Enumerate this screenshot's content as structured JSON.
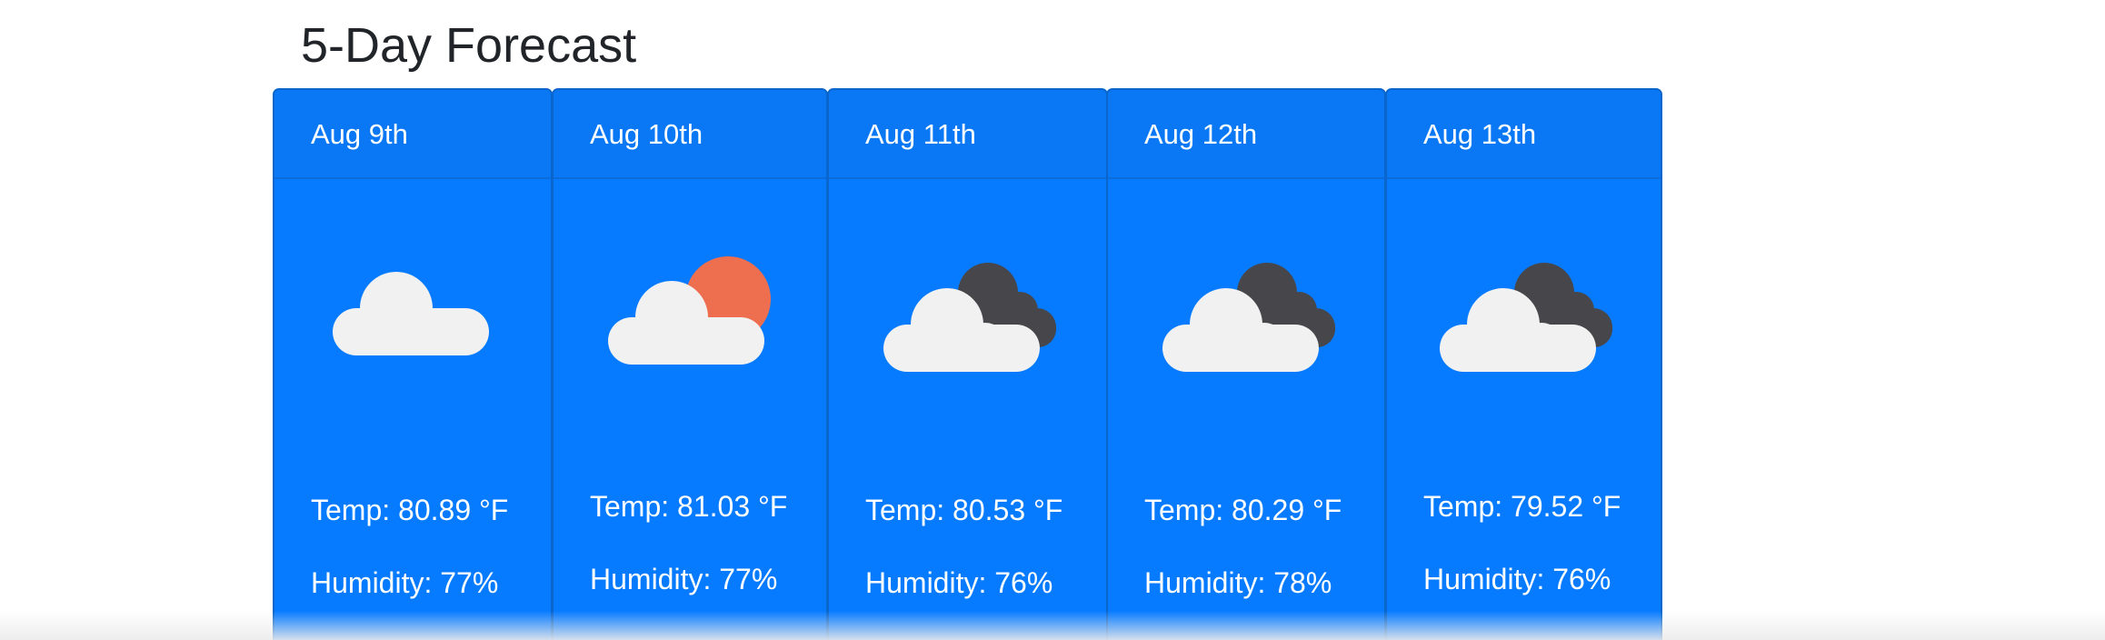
{
  "page": {
    "title": "5-Day Forecast"
  },
  "colors": {
    "card_background": "#077bff",
    "cloud": "#f1f1f1",
    "dark_cloud": "#47474b",
    "sun": "#ee6f4f"
  },
  "forecast": [
    {
      "date": "Aug 9th",
      "icon": "cloud-icon",
      "temp": "Temp: 80.89 °F",
      "humidity": "Humidity: 77%"
    },
    {
      "date": "Aug 10th",
      "icon": "partly-sunny-cloud-icon",
      "temp": "Temp: 81.03 °F",
      "humidity": "Humidity: 77%"
    },
    {
      "date": "Aug 11th",
      "icon": "dark-cloud-icon",
      "temp": "Temp: 80.53 °F",
      "humidity": "Humidity: 76%"
    },
    {
      "date": "Aug 12th",
      "icon": "dark-cloud-icon",
      "temp": "Temp: 80.29 °F",
      "humidity": "Humidity: 78%"
    },
    {
      "date": "Aug 13th",
      "icon": "dark-cloud-icon",
      "temp": "Temp: 79.52 °F",
      "humidity": "Humidity: 76%"
    }
  ]
}
